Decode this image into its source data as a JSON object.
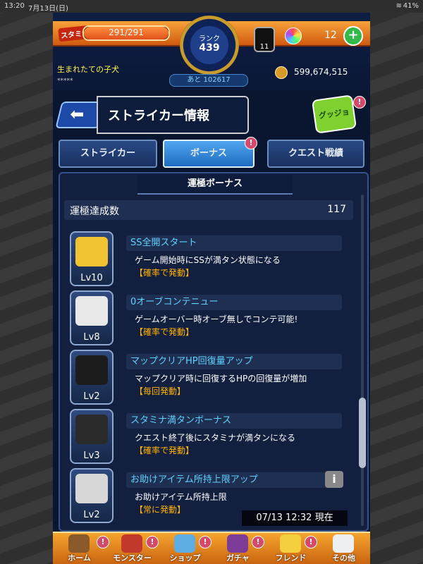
{
  "status_bar": {
    "time": "13:20",
    "date": "7月13日(日)",
    "battery": "41%"
  },
  "header": {
    "stamina_label": "スタミナ",
    "stamina_text": "291/291",
    "stamina_fraction": 1.0,
    "rank_label": "ランク",
    "rank_value": "439",
    "next_exp": "あと 102617",
    "gem_counter": "11",
    "orb_count": "12",
    "plus_label": "+",
    "username": "生まれたての子犬",
    "user_code": "*****",
    "coins": "599,674,515"
  },
  "title": {
    "back_glyph": "⬅",
    "page_title": "ストライカー情報",
    "good_button": "グッジョブ!",
    "good_badge": "!"
  },
  "tabs": [
    {
      "label": "ストライカー",
      "active": false
    },
    {
      "label": "ボーナス",
      "active": true,
      "badge": "!"
    },
    {
      "label": "クエスト戦績",
      "active": false
    }
  ],
  "section": {
    "title": "運極ボーナス",
    "count_label": "運極達成数",
    "count_value": "117"
  },
  "bonuses": [
    {
      "icon": "go-icon",
      "level": "Lv10",
      "name": "SS全開スタート",
      "desc": "ゲーム開始時にSSが満タン状態になる",
      "cond": "【確率で発動】",
      "color": "#f1c232"
    },
    {
      "icon": "winged-arrow-icon",
      "level": "Lv8",
      "name": "0オーブコンテニュー",
      "desc": "ゲームオーバー時オーブ無しでコンテ可能!",
      "cond": "【確率で発動】",
      "color": "#e8e8e8"
    },
    {
      "icon": "hp-gauge-icon",
      "level": "Lv2",
      "name": "マップクリアHP回復量アップ",
      "desc": "マップクリア時に回復するHPの回復量が増加",
      "cond": "【毎回発動】",
      "color": "#1c1c1c"
    },
    {
      "icon": "stamina-gauge-icon",
      "level": "Lv3",
      "name": "スタミナ満タンボーナス",
      "desc": "クエスト終了後にスタミナが満タンになる",
      "cond": "【確率で発動】",
      "color": "#2a2a2a"
    },
    {
      "icon": "helper-item-icon",
      "level": "Lv2",
      "name": "お助けアイテム所持上限アップ",
      "desc": "お助けアイテム所持上限",
      "cond": "【常に発動】",
      "color": "#d7d7d7",
      "info": "i"
    }
  ],
  "timestamp": "07/13 12:32 現在",
  "nav": [
    {
      "label": "ホーム",
      "icon": "home-icon",
      "color": "#8a5a2b"
    },
    {
      "label": "モンスター",
      "icon": "monster-icon",
      "color": "#c0392b"
    },
    {
      "label": "ショップ",
      "icon": "shop-orb-icon",
      "color": "#5dade2"
    },
    {
      "label": "ガチャ",
      "icon": "gacha-icon",
      "color": "#7d3c98"
    },
    {
      "label": "フレンド",
      "icon": "friend-icon",
      "color": "#f4d03f"
    },
    {
      "label": "その他",
      "icon": "other-icon",
      "color": "#ecf0f1"
    }
  ],
  "nav_badge": "!"
}
